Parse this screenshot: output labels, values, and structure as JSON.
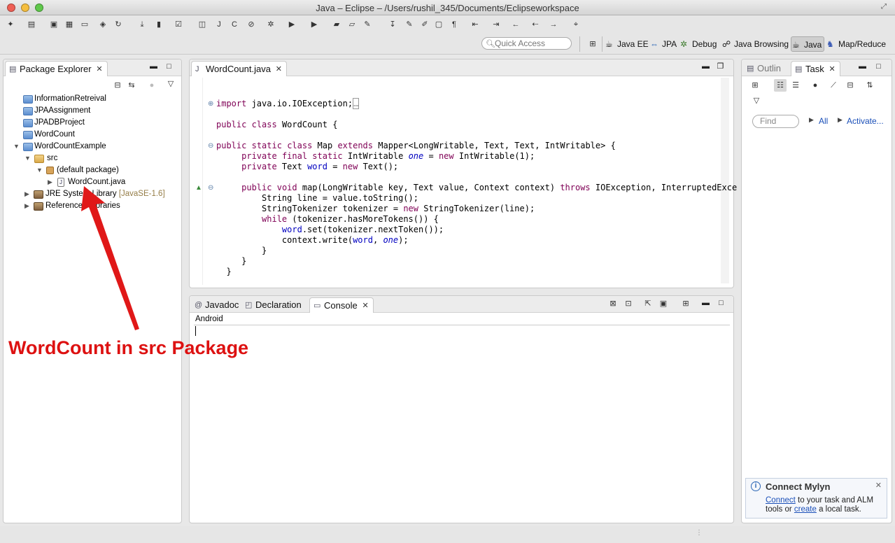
{
  "window": {
    "title": "Java – Eclipse – /Users/rushil_345/Documents/Eclipseworkspace"
  },
  "quick_access": {
    "placeholder": "Quick Access"
  },
  "perspectives": [
    {
      "label": "Java EE",
      "icon": "java-ee-icon"
    },
    {
      "label": "JPA",
      "icon": "jpa-icon"
    },
    {
      "label": "Debug",
      "icon": "debug-icon"
    },
    {
      "label": "Java Browsing",
      "icon": "java-browsing-icon"
    },
    {
      "label": "Java",
      "icon": "java-perspective-icon",
      "active": true
    },
    {
      "label": "Map/Reduce",
      "icon": "elephant-icon"
    }
  ],
  "package_explorer": {
    "tab_label": "Package Explorer",
    "tree": [
      {
        "label": "InformationRetreival",
        "type": "project"
      },
      {
        "label": "JPAAssignment",
        "type": "project"
      },
      {
        "label": "JPADBProject",
        "type": "project"
      },
      {
        "label": "WordCount",
        "type": "project"
      },
      {
        "label": "WordCountExample",
        "type": "project",
        "expanded": true
      },
      {
        "label": "src",
        "type": "source-folder",
        "expanded": true
      },
      {
        "label": "(default package)",
        "type": "package",
        "expanded": true
      },
      {
        "label": "WordCount.java",
        "type": "java-file"
      },
      {
        "label": "JRE System Library",
        "suffix": "[JavaSE-1.6]",
        "type": "library"
      },
      {
        "label": "Referenced Libraries",
        "type": "library"
      }
    ]
  },
  "editor": {
    "tab_label": "WordCount.java",
    "lines": [
      "import java.io.IOException;",
      "public class WordCount {",
      "public static class Map extends Mapper<LongWritable, Text, Text, IntWritable> {",
      "    private final static IntWritable one = new IntWritable(1);",
      "    private Text word = new Text();",
      "    public void map(LongWritable key, Text value, Context context) throws IOException, InterruptedExce",
      "        String line = value.toString();",
      "        StringTokenizer tokenizer = new StringTokenizer(line);",
      "        while (tokenizer.hasMoreTokens()) {",
      "            word.set(tokenizer.nextToken());",
      "            context.write(word, one);",
      "        }",
      "    }",
      "  }"
    ]
  },
  "bottom_panel": {
    "tabs": [
      "Javadoc",
      "Declaration",
      "Console"
    ],
    "active_tab": "Console",
    "console_name": "Android"
  },
  "right_panel": {
    "tabs": [
      "Outlin",
      "Task"
    ],
    "active_tab": "Task",
    "find_placeholder": "Find",
    "all_label": "All",
    "activate_label": "Activate...",
    "mylyn": {
      "title": "Connect Mylyn",
      "connect_link": "Connect",
      "text_middle": " to your task and ALM tools or ",
      "create_link": "create",
      "text_end": " a local task."
    }
  },
  "annotation": {
    "text": "WordCount in src Package",
    "color": "#dd1111"
  },
  "colors": {
    "keyword": "#7f0055",
    "field": "#0000c0",
    "accent": "#2a65b5"
  }
}
